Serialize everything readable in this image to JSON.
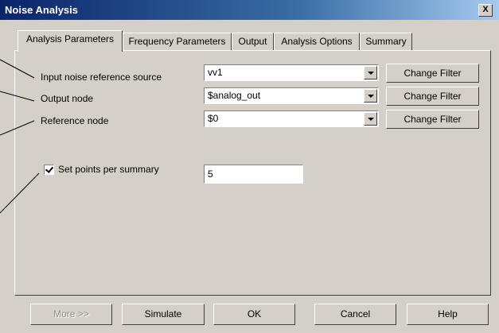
{
  "window": {
    "title": "Noise Analysis",
    "close_label": "X"
  },
  "tabs": [
    {
      "label": "Analysis Parameters",
      "active": true
    },
    {
      "label": "Frequency Parameters"
    },
    {
      "label": "Output"
    },
    {
      "label": "Analysis Options"
    },
    {
      "label": "Summary"
    }
  ],
  "fields": {
    "input_noise": {
      "label": "Input noise reference source",
      "value": "vv1",
      "filter_button": "Change Filter"
    },
    "output_node": {
      "label": "Output node",
      "value": "$analog_out",
      "filter_button": "Change Filter"
    },
    "reference_node": {
      "label": "Reference node",
      "value": "$0",
      "filter_button": "Change Filter"
    }
  },
  "set_points": {
    "label": "Set points per summary",
    "checked": true,
    "value": "5"
  },
  "footer": {
    "more": "More >>",
    "simulate": "Simulate",
    "ok": "OK",
    "cancel": "Cancel",
    "help": "Help"
  }
}
